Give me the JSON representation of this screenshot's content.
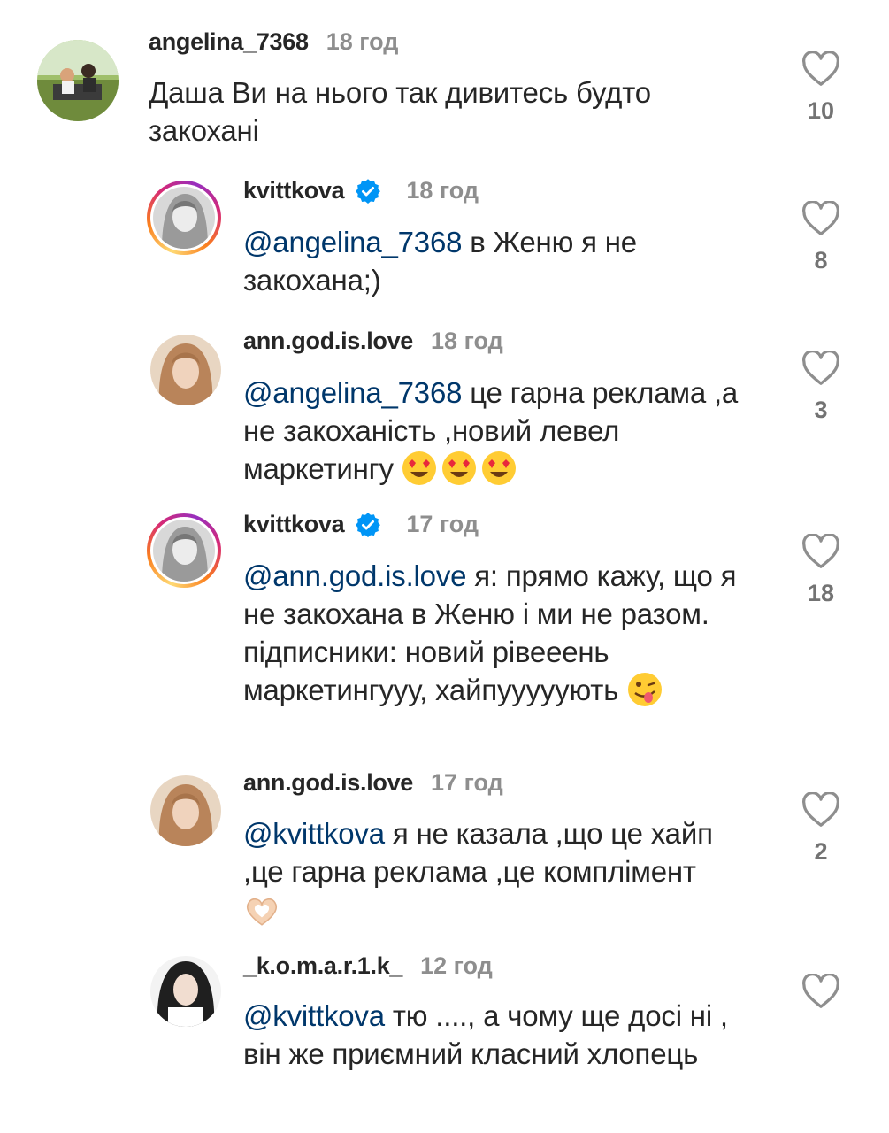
{
  "comments": [
    {
      "username": "angelina_7368",
      "time": "18 год",
      "mention": "",
      "text": "Даша Ви на нього так дивитесь будто закохані",
      "likes": "10"
    },
    {
      "username": "kvittkova",
      "time": "18 год",
      "mention": "@angelina_7368",
      "text": " в Женю я не закохана;)",
      "likes": "8"
    },
    {
      "username": "ann.god.is.love",
      "time": "18 год",
      "mention": "@angelina_7368",
      "text": " це гарна реклама ,а не закоханість ,новий левел маркетингу ",
      "likes": "3"
    },
    {
      "username": "kvittkova",
      "time": "17 год",
      "mention": "@ann.god.is.love",
      "text": " я: прямо кажу, що я не закохана в Женю і ми не разом. підписники: новий рівееень маркетингууу, хайпууууують ",
      "likes": "18"
    },
    {
      "username": "ann.god.is.love",
      "time": "17 год",
      "mention": "@kvittkova",
      "text": " я не казала ,що це хайп ,це гарна реклама ,це комплімент ",
      "likes": "2"
    },
    {
      "username": "_k.o.m.a.r.1.k_",
      "time": "12 год",
      "mention": "@kvittkova",
      "text": " тю ...., а чому ще досі ні , він же приємний класний хлопець",
      "likes": ""
    }
  ],
  "icons": {
    "like": "heart-outline-icon",
    "verified": "verified-badge-icon",
    "emoji_heart_eyes": "heart-eyes-emoji",
    "emoji_winking_tongue": "winking-tongue-emoji",
    "emoji_heart_hands": "heart-hands-emoji"
  },
  "colors": {
    "mention": "#00376b",
    "verified": "#0095f6",
    "meta_gray": "#8e8e8e"
  }
}
